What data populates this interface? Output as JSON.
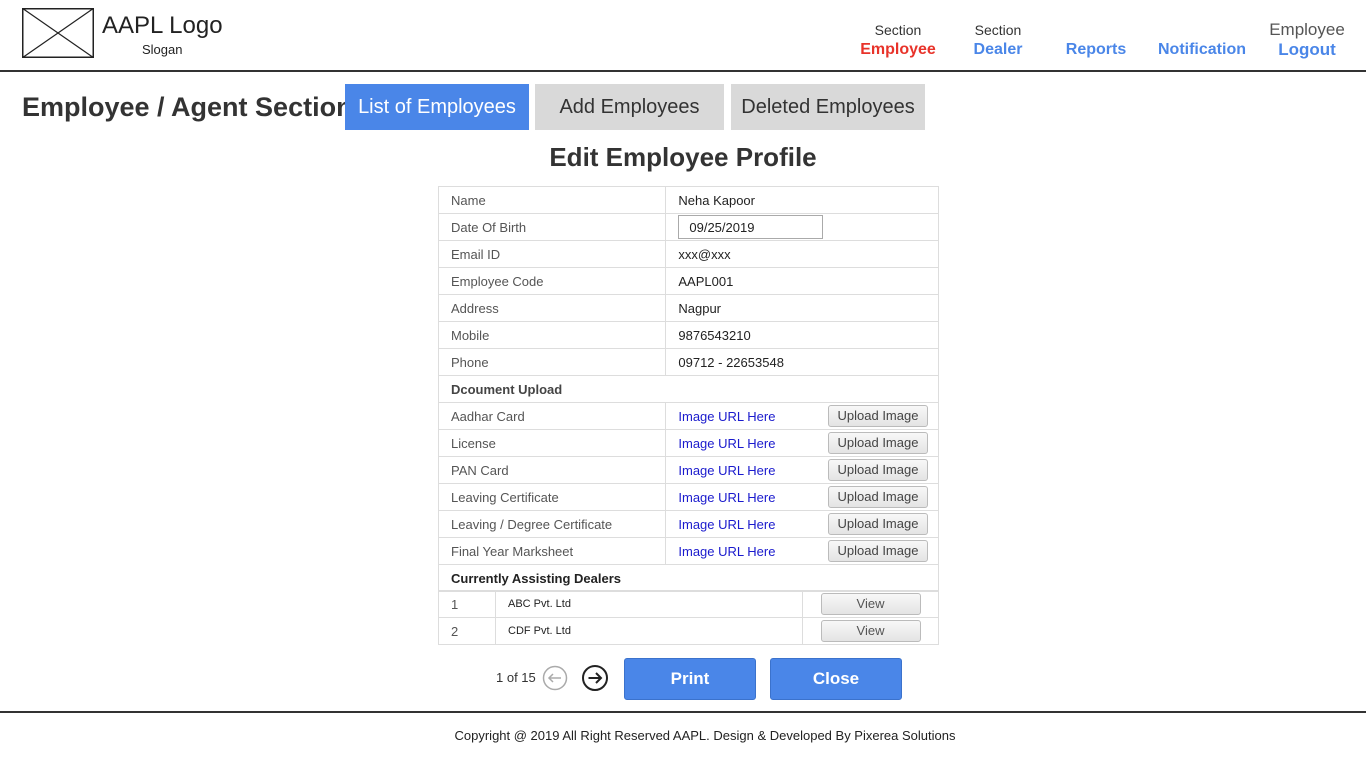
{
  "header": {
    "logo_text": "AAPL Logo",
    "slogan": "Slogan",
    "nav": [
      {
        "sub": "Section",
        "label": "Employee"
      },
      {
        "sub": "Section",
        "label": "Dealer"
      },
      {
        "sub": "",
        "label": "Reports"
      },
      {
        "sub": "",
        "label": "Notification"
      }
    ],
    "user_label": "Employee",
    "logout_label": "Logout"
  },
  "section": {
    "title": "Employee / Agent Section",
    "tabs": [
      "List of Employees",
      "Add Employees",
      "Deleted Employees"
    ]
  },
  "form": {
    "title": "Edit Employee Profile",
    "fields": [
      {
        "label": "Name",
        "value": "Neha Kapoor"
      },
      {
        "label": "Date Of Birth",
        "value": "09/25/2019"
      },
      {
        "label": "Email ID",
        "value": "xxx@xxx"
      },
      {
        "label": "Employee Code",
        "value": "AAPL001"
      },
      {
        "label": "Address",
        "value": "Nagpur"
      },
      {
        "label": "Mobile",
        "value": "9876543210"
      },
      {
        "label": "Phone",
        "value": "09712 - 22653548"
      }
    ],
    "documents_heading": "Dcoument Upload",
    "documents": [
      {
        "label": "Aadhar Card",
        "link": "Image URL Here",
        "button": "Upload Image"
      },
      {
        "label": "License",
        "link": "Image URL Here",
        "button": "Upload Image"
      },
      {
        "label": "PAN Card",
        "link": "Image URL Here",
        "button": "Upload Image"
      },
      {
        "label": "Leaving Certificate",
        "link": "Image URL Here",
        "button": "Upload Image"
      },
      {
        "label": "Leaving / Degree Certificate",
        "link": "Image URL Here",
        "button": "Upload Image"
      },
      {
        "label": "Final Year Marksheet",
        "link": "Image URL Here",
        "button": "Upload Image"
      }
    ],
    "dealers_heading": "Currently Assisting Dealers",
    "dealers": [
      {
        "num": "1",
        "name": "ABC Pvt. Ltd",
        "button": "View"
      },
      {
        "num": "2",
        "name": "CDF Pvt. Ltd",
        "button": "View"
      }
    ]
  },
  "pager": {
    "text": "1 of 15"
  },
  "actions": {
    "print": "Print",
    "close": "Close"
  },
  "footer": {
    "text": "Copyright @ 2019 All Right Reserved AAPL. Design & Developed By Pixerea Solutions"
  },
  "colors": {
    "accent": "#4a86e8",
    "active_nav": "#e8332a",
    "tab_inactive": "#d9d9d9",
    "link": "#1a1acd"
  }
}
